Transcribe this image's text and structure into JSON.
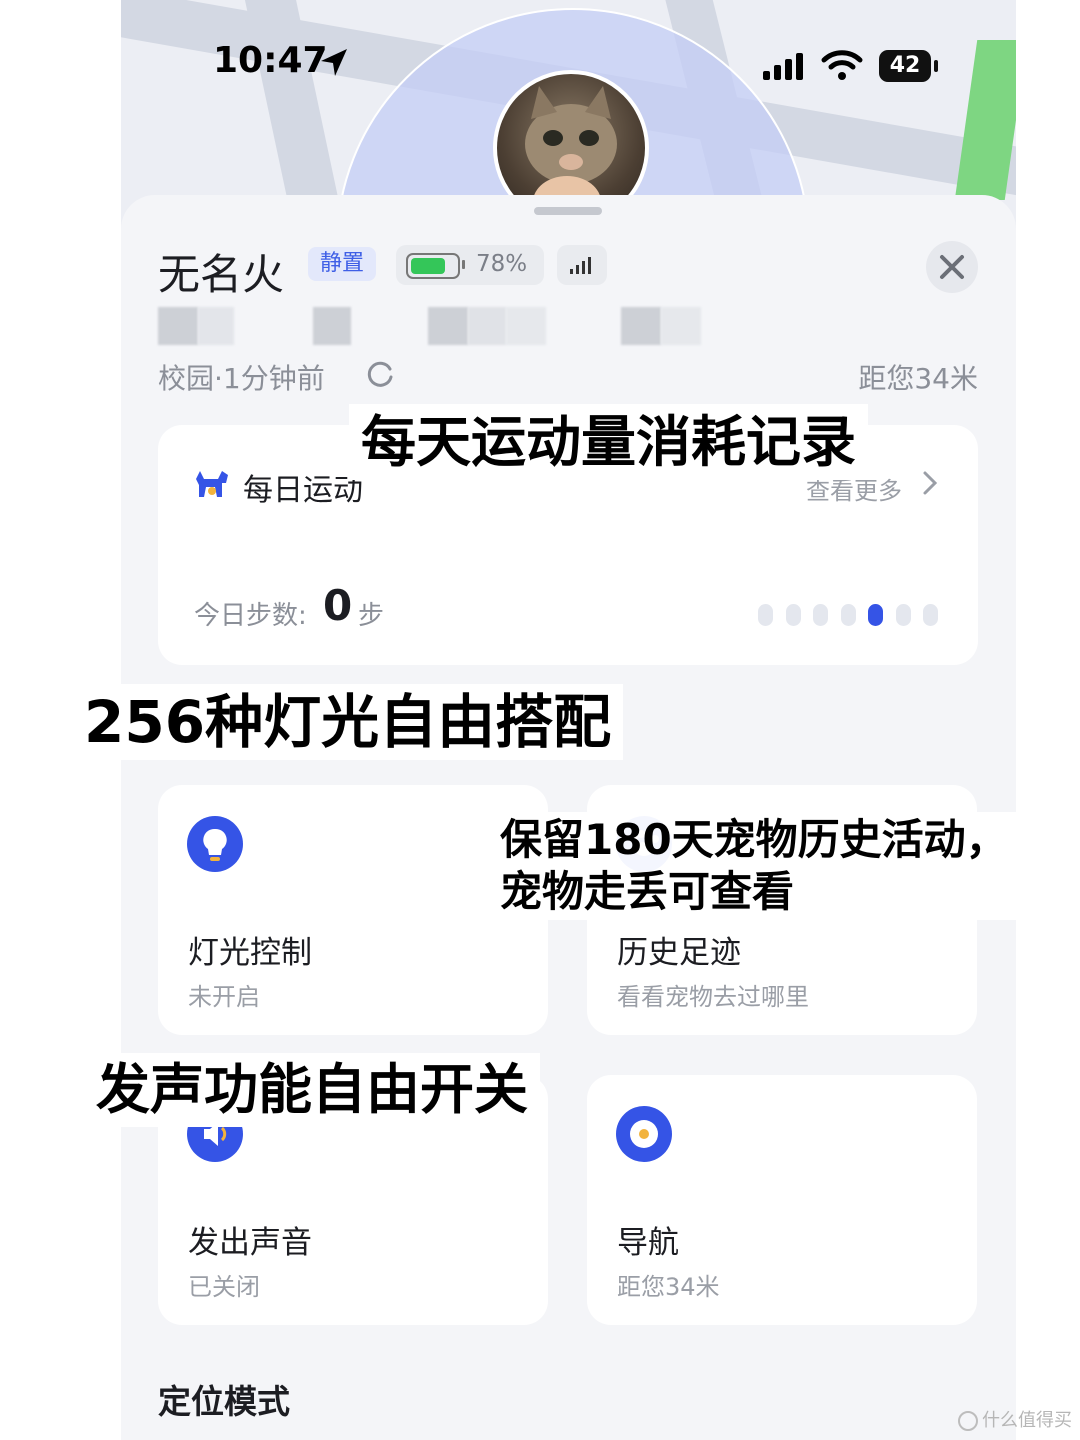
{
  "status_bar": {
    "time": "10:47",
    "battery_level": "42"
  },
  "pet": {
    "name": "无名火",
    "mode_badge": "静置",
    "device_battery": "78%",
    "device_battery_fraction": 0.78,
    "location_meta": "校园·1分钟前",
    "distance": "距您34米"
  },
  "daily_activity": {
    "title": "每日运动",
    "view_more": "查看更多",
    "steps_label": "今日步数:",
    "steps_value": "0",
    "steps_unit": "步",
    "pager_dots": 7,
    "pager_active_index": 4
  },
  "features": [
    {
      "title": "灯光控制",
      "subtitle": "未开启",
      "icon": "lightbulb-icon"
    },
    {
      "title": "历史足迹",
      "subtitle": "看看宠物去过哪里",
      "icon": "footprint-icon"
    },
    {
      "title": "发出声音",
      "subtitle": "已关闭",
      "icon": "sound-icon"
    },
    {
      "title": "导航",
      "subtitle": "距您34米",
      "icon": "location-pin-icon"
    }
  ],
  "section_title": "定位模式",
  "overlays": {
    "o1": "每天运动量消耗记录",
    "o2": "256种灯光自由搭配",
    "o3_line1": "保留180天宠物历史活动，",
    "o3_line2": "宠物走丢可查看",
    "o4": "发声功能自由开关"
  },
  "watermark": "什么值得买",
  "colors": {
    "accent": "#3554e6",
    "battery_green": "#34c659",
    "badge_bg": "#e3e8fb"
  }
}
